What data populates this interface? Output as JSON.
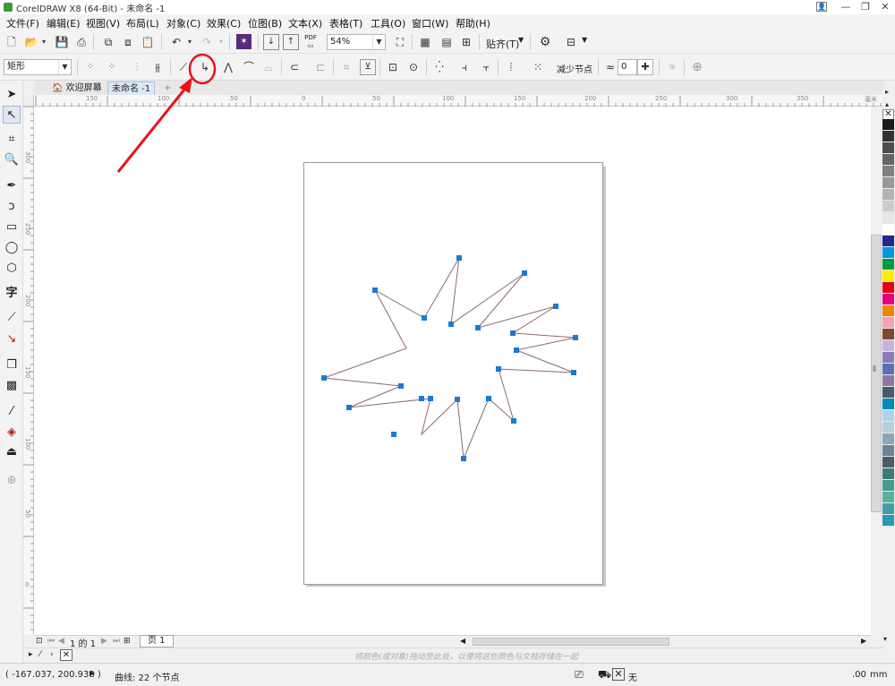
{
  "window": {
    "title": "CorelDRAW X8 (64-Bit) - 未命名 -1",
    "controls": [
      "minimize-icon",
      "restore-icon",
      "close-icon"
    ]
  },
  "menu": [
    "文件(F)",
    "编辑(E)",
    "视图(V)",
    "布局(L)",
    "对象(C)",
    "效果(C)",
    "位图(B)",
    "文本(X)",
    "表格(T)",
    "工具(O)",
    "窗口(W)",
    "帮助(H)"
  ],
  "toolbar": {
    "pdf_label": "PDF",
    "zoom": "54%",
    "snap_label": "贴齐(T)"
  },
  "property_bar": {
    "shape_type": "矩形",
    "reduce_nodes_label": "减少节点",
    "smoothness_value": "0"
  },
  "tabs": {
    "welcome": "欢迎屏幕",
    "document": "未命名 -1"
  },
  "ruler": {
    "h_ticks": [
      "150",
      "100",
      "50",
      "0",
      "50",
      "100",
      "150",
      "200",
      "250",
      "300",
      "350"
    ],
    "unit_label": "毫米",
    "v_ticks": [
      "300",
      "250",
      "200",
      "150",
      "100",
      "50",
      "0"
    ]
  },
  "page_nav": {
    "counter": "1 的 1",
    "page_tab": "页 1"
  },
  "color_bar": {
    "hint": "将颜色(或对象)拖动至此处，以便将这些颜色与文档存储在一起"
  },
  "status": {
    "coordinates": "( -167.037, 200.938 )",
    "selection_info": "曲线: 22 个节点",
    "fill_none": "无",
    "unit_right": "mm",
    "unit_digit": ".00"
  },
  "palette_colors": [
    "#1a1a1a",
    "#333333",
    "#4d4d4d",
    "#666666",
    "#808080",
    "#999999",
    "#b3b3b3",
    "#cccccc",
    "#e6e6e6",
    "#ffffff",
    "#1f2a8c",
    "#0099dd",
    "#009944",
    "#ffee00",
    "#e60012",
    "#e4007f",
    "#f08300",
    "#f5a3b0",
    "#7a4b2f",
    "#c8b4d8",
    "#8a7ab8",
    "#5b6fb5",
    "#8a78a8",
    "#4a5870",
    "#0a8ab8",
    "#a8d4ef",
    "#b8cfdb",
    "#8aa6b8",
    "#6a8494",
    "#4b5c66",
    "#3d7a70",
    "#4b9a8a",
    "#5ab0a0",
    "#40a0a8",
    "#2a9ab0"
  ],
  "annotation_color": "#e8141c"
}
